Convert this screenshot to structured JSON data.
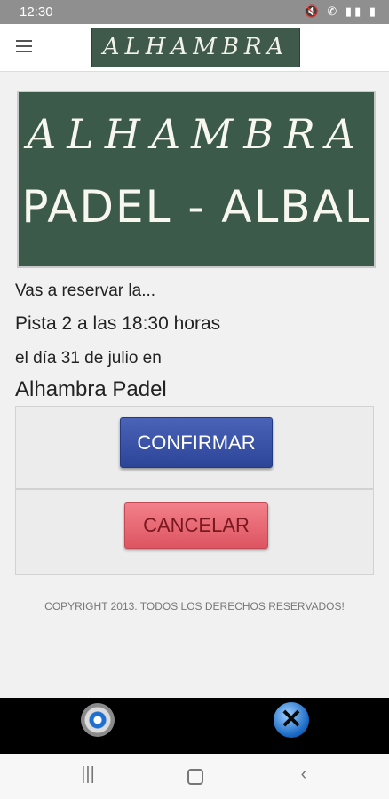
{
  "status_bar": {
    "time": "12:30",
    "icons": "🔇 ✆ ▮▮ ▮"
  },
  "header": {
    "logo_text": "ALHAMBRA",
    "menu_icon": "hamburger-icon"
  },
  "banner": {
    "line1": "ALHAMBRA",
    "line2": "PADEL - ALBAL"
  },
  "reservation": {
    "intro": "Vas a reservar la...",
    "court_time": "Pista 2 a las 18:30 horas",
    "date_line": "el día 31 de julio en",
    "venue": "Alhambra Padel"
  },
  "actions": {
    "confirm_label": "CONFIRMAR",
    "cancel_label": "CANCELAR"
  },
  "footer": {
    "copyright": "COPYRIGHT 2013. TODOS LOS DERECHOS RESERVADOS!"
  },
  "bottom_bar": {
    "left_icon": "settings-gear-icon",
    "right_icon": "close-icon"
  },
  "colors": {
    "confirm": "#2d4597",
    "cancel": "#dd5561",
    "banner": "#3b5a4a"
  }
}
